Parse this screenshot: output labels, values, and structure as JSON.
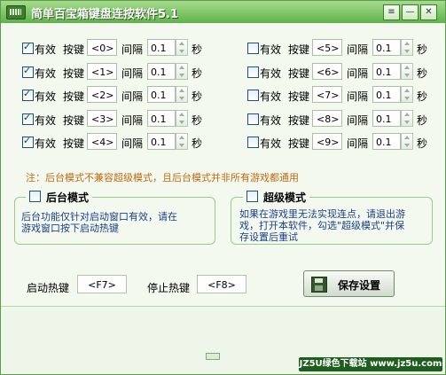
{
  "window": {
    "title": "简单百宝箱键盘连按软件5.1"
  },
  "titlebar_buttons": {
    "menu": "≡",
    "minimize": "—",
    "close": "✕"
  },
  "labels": {
    "valid": "有效",
    "key": "按键",
    "interval": "间隔",
    "seconds": "秒"
  },
  "left_rows": [
    {
      "checked": true,
      "key": "<0>",
      "interval": "0.1"
    },
    {
      "checked": true,
      "key": "<1>",
      "interval": "0.1"
    },
    {
      "checked": true,
      "key": "<2>",
      "interval": "0.1"
    },
    {
      "checked": true,
      "key": "<3>",
      "interval": "0.1"
    },
    {
      "checked": true,
      "key": "<4>",
      "interval": "0.1"
    }
  ],
  "right_rows": [
    {
      "checked": false,
      "key": "<5>",
      "interval": "0.1"
    },
    {
      "checked": false,
      "key": "<6>",
      "interval": "0.1"
    },
    {
      "checked": false,
      "key": "<7>",
      "interval": "0.1"
    },
    {
      "checked": false,
      "key": "<8>",
      "interval": "0.1"
    },
    {
      "checked": false,
      "key": "<9>",
      "interval": "0.1"
    }
  ],
  "note": "注：后台模式不兼容超级模式，且后台模式并非所有游戏都通用",
  "background_mode": {
    "title": "后台模式",
    "checked": false,
    "line1": "后台功能仅针对启动窗口有效，请在",
    "line2": "游戏窗口按下启动热键"
  },
  "super_mode": {
    "title": "超级模式",
    "checked": false,
    "line1": "如果在游戏里无法实现连点，请退出游",
    "line2": "戏，打开本软件，勾选\"超级模式\"并保",
    "line3": "存设置后重试"
  },
  "hotkeys": {
    "start_label": "启动热键",
    "start_value": "<F7>",
    "stop_label": "停止热键",
    "stop_value": "<F8>"
  },
  "save_button": {
    "label": "保存设置"
  },
  "watermark": "JZ5U绿色下载站 www.jz5u.com",
  "colors": {
    "title_bar": "#5fb24a",
    "note_text": "#c06a10",
    "desc_text": "#1d3f88",
    "group_border": "#9ec88d"
  }
}
